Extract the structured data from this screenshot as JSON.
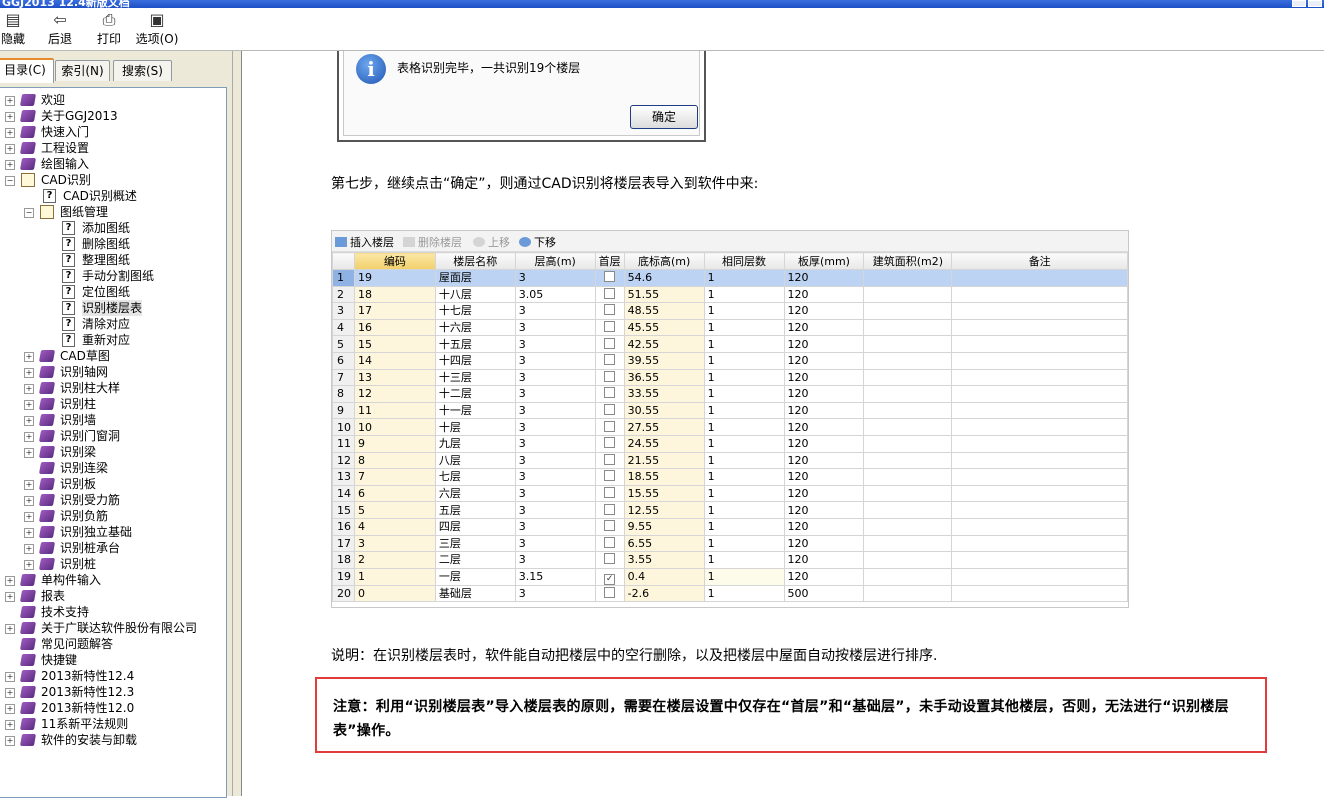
{
  "window": {
    "title": "GGJ2013 12.4新版文档"
  },
  "toolbar": {
    "buttons": [
      {
        "label": "隐藏",
        "icon": "hide-icon"
      },
      {
        "label": "后退",
        "icon": "back-arrow-icon"
      },
      {
        "label": "打印",
        "icon": "printer-icon"
      },
      {
        "label": "选项(O)",
        "icon": "options-icon"
      }
    ]
  },
  "sidebar": {
    "tabs": [
      "目录(C)",
      "索引(N)",
      "搜索(S)"
    ],
    "tree": [
      "欢迎",
      "关于GGJ2013",
      "快速入门",
      "工程设置",
      "绘图输入",
      "CAD识别",
      "CAD识别概述",
      "图纸管理",
      "添加图纸",
      "删除图纸",
      "整理图纸",
      "手动分割图纸",
      "定位图纸",
      "识别楼层表",
      "清除对应",
      "重新对应",
      "CAD草图",
      "识别轴网",
      "识别柱大样",
      "识别柱",
      "识别墙",
      "识别门窗洞",
      "识别梁",
      "识别连梁",
      "识别板",
      "识别受力筋",
      "识别负筋",
      "识别独立基础",
      "识别桩承台",
      "识别桩",
      "单构件输入",
      "报表",
      "技术支持",
      "关于广联达软件股份有限公司",
      "常见问题解答",
      "快捷键",
      "2013新特性12.4",
      "2013新特性12.3",
      "2013新特性12.0",
      "11系新平法规则",
      "软件的安装与卸载"
    ]
  },
  "dialog": {
    "message": "表格识别完毕，一共识别19个楼层",
    "ok_label": "确定"
  },
  "content": {
    "step_text": "第七步，继续点击“确定”，则通过CAD识别将楼层表导入到软件中来:",
    "explain_text": "说明：在识别楼层表时，软件能自动把楼层中的空行删除，以及把楼层中屋面自动按楼层进行排序.",
    "note_text": "注意：利用“识别楼层表”导入楼层表的原则，需要在楼层设置中仅存在“首层”和“基础层”，未手动设置其他楼层，否则，无法进行“识别楼层表”操作。"
  },
  "grid": {
    "toolbar": [
      "插入楼层",
      "删除楼层",
      "上移",
      "下移"
    ],
    "headers": [
      "",
      "编码",
      "楼层名称",
      "层高(m)",
      "首层",
      "底标高(m)",
      "相同层数",
      "板厚(mm)",
      "建筑面积(m2)",
      "备注"
    ],
    "rows": [
      [
        "1",
        "19",
        "屋面层",
        "3",
        false,
        "54.6",
        "1",
        "120"
      ],
      [
        "2",
        "18",
        "十八层",
        "3.05",
        false,
        "51.55",
        "1",
        "120"
      ],
      [
        "3",
        "17",
        "十七层",
        "3",
        false,
        "48.55",
        "1",
        "120"
      ],
      [
        "4",
        "16",
        "十六层",
        "3",
        false,
        "45.55",
        "1",
        "120"
      ],
      [
        "5",
        "15",
        "十五层",
        "3",
        false,
        "42.55",
        "1",
        "120"
      ],
      [
        "6",
        "14",
        "十四层",
        "3",
        false,
        "39.55",
        "1",
        "120"
      ],
      [
        "7",
        "13",
        "十三层",
        "3",
        false,
        "36.55",
        "1",
        "120"
      ],
      [
        "8",
        "12",
        "十二层",
        "3",
        false,
        "33.55",
        "1",
        "120"
      ],
      [
        "9",
        "11",
        "十一层",
        "3",
        false,
        "30.55",
        "1",
        "120"
      ],
      [
        "10",
        "10",
        "十层",
        "3",
        false,
        "27.55",
        "1",
        "120"
      ],
      [
        "11",
        "9",
        "九层",
        "3",
        false,
        "24.55",
        "1",
        "120"
      ],
      [
        "12",
        "8",
        "八层",
        "3",
        false,
        "21.55",
        "1",
        "120"
      ],
      [
        "13",
        "7",
        "七层",
        "3",
        false,
        "18.55",
        "1",
        "120"
      ],
      [
        "14",
        "6",
        "六层",
        "3",
        false,
        "15.55",
        "1",
        "120"
      ],
      [
        "15",
        "5",
        "五层",
        "3",
        false,
        "12.55",
        "1",
        "120"
      ],
      [
        "16",
        "4",
        "四层",
        "3",
        false,
        "9.55",
        "1",
        "120"
      ],
      [
        "17",
        "3",
        "三层",
        "3",
        false,
        "6.55",
        "1",
        "120"
      ],
      [
        "18",
        "2",
        "二层",
        "3",
        false,
        "3.55",
        "1",
        "120"
      ],
      [
        "19",
        "1",
        "一层",
        "3.15",
        true,
        "0.4",
        "1",
        "120"
      ],
      [
        "20",
        "0",
        "基础层",
        "3",
        false,
        "-2.6",
        "1",
        "500"
      ]
    ]
  },
  "colors": {
    "accent_red": "#e23b3b",
    "selection": "#bcd3f3",
    "code_column": "#fdf6dc"
  }
}
